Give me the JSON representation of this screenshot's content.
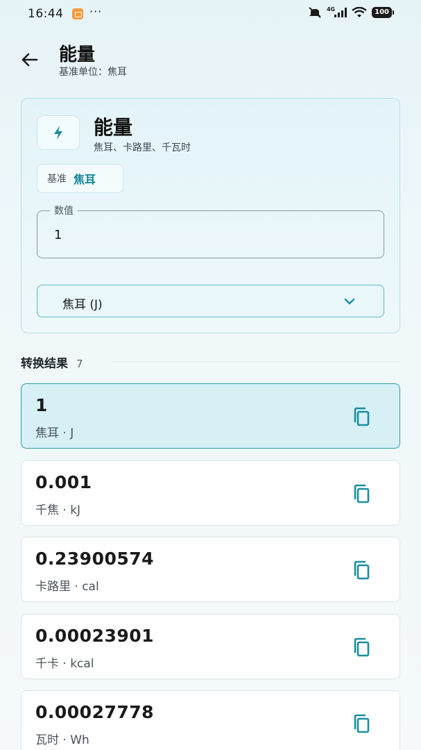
{
  "status_bar": {
    "time": "16:44",
    "dots": "···",
    "network": "4G",
    "battery": "100"
  },
  "header": {
    "title": "能量",
    "subtitle": "基准单位：焦耳"
  },
  "category_card": {
    "name": "能量",
    "units": "焦耳、卡路里、千瓦时",
    "base_label": "基准",
    "base_value": "焦耳",
    "value_label": "数值",
    "value": "1",
    "selected_unit": "焦耳 (J)"
  },
  "results": {
    "title": "转换结果",
    "count": "7",
    "items": [
      {
        "value": "1",
        "unit": "焦耳 · J"
      },
      {
        "value": "0.001",
        "unit": "千焦 · kJ"
      },
      {
        "value": "0.23900574",
        "unit": "卡路里 · cal"
      },
      {
        "value": "0.00023901",
        "unit": "千卡 · kcal"
      },
      {
        "value": "0.00027778",
        "unit": "瓦时 · Wh"
      }
    ]
  },
  "colors": {
    "accent": "#0e8596",
    "active_card_bg": "#d6f0f6",
    "icon_teal": "#1a8ea0"
  },
  "icons": [
    "back-arrow-icon",
    "bolt-icon",
    "chevron-down-icon",
    "copy-icon"
  ]
}
